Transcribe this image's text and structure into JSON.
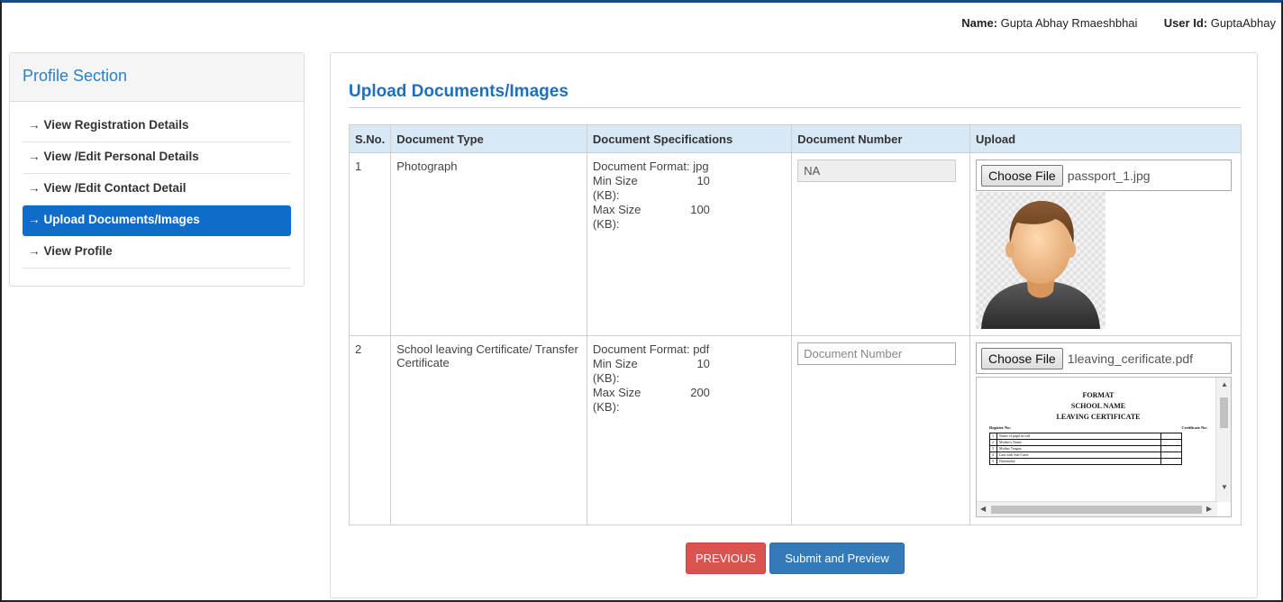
{
  "header": {
    "name_label": "Name:",
    "name_value": "Gupta Abhay Rmaeshbhai",
    "userid_label": "User Id:",
    "userid_value": "GuptaAbhay"
  },
  "sidebar": {
    "title": "Profile Section",
    "items": [
      {
        "label": "View Registration Details",
        "active": false
      },
      {
        "label": "View /Edit Personal Details",
        "active": false
      },
      {
        "label": "View /Edit Contact Detail",
        "active": false
      },
      {
        "label": "Upload Documents/Images",
        "active": true
      },
      {
        "label": "View Profile",
        "active": false
      }
    ],
    "arrow": "→"
  },
  "main": {
    "title": "Upload Documents/Images",
    "table": {
      "headers": [
        "S.No.",
        "Document Type",
        "Document Specifications",
        "Document Number",
        "Upload"
      ],
      "rows": [
        {
          "sno": "1",
          "doc_type": "Photograph",
          "format_label": "Document Format:",
          "format_value": "jpg",
          "min_label": "Min Size (KB):",
          "min_value": "10",
          "max_label": "Max Size (KB):",
          "max_value": "100",
          "doc_number_value": "NA",
          "doc_number_placeholder": "",
          "choose_label": "Choose File",
          "file_name": "passport_1.jpg"
        },
        {
          "sno": "2",
          "doc_type": "School leaving Certificate/ Transfer Certificate",
          "format_label": "Document Format:",
          "format_value": "pdf",
          "min_label": "Min Size (KB):",
          "min_value": "10",
          "max_label": "Max Size (KB):",
          "max_value": "200",
          "doc_number_value": "",
          "doc_number_placeholder": "Document Number",
          "choose_label": "Choose File",
          "file_name": "1leaving_cerificate.pdf",
          "preview": {
            "line1": "FORMAT",
            "line2": "SCHOOL NAME",
            "line3": "LEAVING CERTIFICATE",
            "register_label": "Register No:",
            "certificate_label": "Certificate No:",
            "fields": [
              "Name of pupil in full",
              "Mother's Name",
              "Mother Tongue",
              "Cast with Sub Caste",
              "Nationality"
            ]
          }
        }
      ]
    }
  },
  "actions": {
    "previous_label": "PREVIOUS",
    "submit_label": "Submit and Preview"
  },
  "colors": {
    "accent": "#0f6cc9",
    "title": "#1f6fbf",
    "table_header_bg": "#d9e8f5",
    "previous_bg": "#d9534f",
    "submit_bg": "#337ab7"
  }
}
